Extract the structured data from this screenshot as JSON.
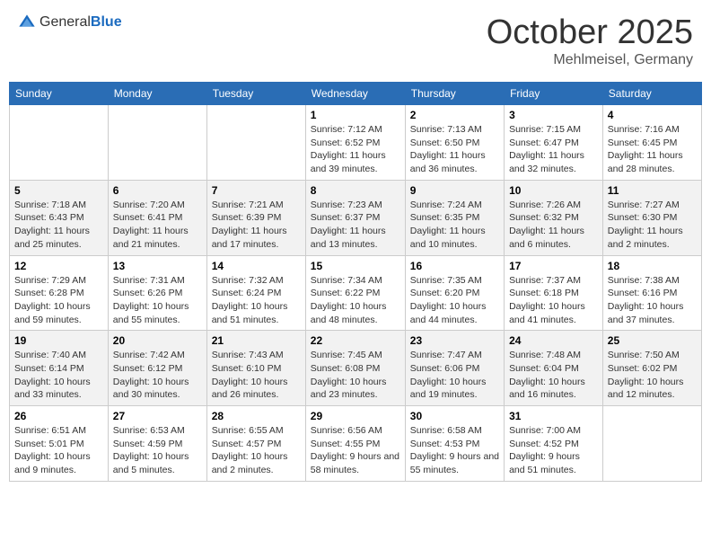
{
  "header": {
    "logo_general": "General",
    "logo_blue": "Blue",
    "title": "October 2025",
    "subtitle": "Mehlmeisel, Germany"
  },
  "days_of_week": [
    "Sunday",
    "Monday",
    "Tuesday",
    "Wednesday",
    "Thursday",
    "Friday",
    "Saturday"
  ],
  "weeks": [
    {
      "days": [
        {
          "num": "",
          "info": ""
        },
        {
          "num": "",
          "info": ""
        },
        {
          "num": "",
          "info": ""
        },
        {
          "num": "1",
          "info": "Sunrise: 7:12 AM\nSunset: 6:52 PM\nDaylight: 11 hours and 39 minutes."
        },
        {
          "num": "2",
          "info": "Sunrise: 7:13 AM\nSunset: 6:50 PM\nDaylight: 11 hours and 36 minutes."
        },
        {
          "num": "3",
          "info": "Sunrise: 7:15 AM\nSunset: 6:47 PM\nDaylight: 11 hours and 32 minutes."
        },
        {
          "num": "4",
          "info": "Sunrise: 7:16 AM\nSunset: 6:45 PM\nDaylight: 11 hours and 28 minutes."
        }
      ]
    },
    {
      "days": [
        {
          "num": "5",
          "info": "Sunrise: 7:18 AM\nSunset: 6:43 PM\nDaylight: 11 hours and 25 minutes."
        },
        {
          "num": "6",
          "info": "Sunrise: 7:20 AM\nSunset: 6:41 PM\nDaylight: 11 hours and 21 minutes."
        },
        {
          "num": "7",
          "info": "Sunrise: 7:21 AM\nSunset: 6:39 PM\nDaylight: 11 hours and 17 minutes."
        },
        {
          "num": "8",
          "info": "Sunrise: 7:23 AM\nSunset: 6:37 PM\nDaylight: 11 hours and 13 minutes."
        },
        {
          "num": "9",
          "info": "Sunrise: 7:24 AM\nSunset: 6:35 PM\nDaylight: 11 hours and 10 minutes."
        },
        {
          "num": "10",
          "info": "Sunrise: 7:26 AM\nSunset: 6:32 PM\nDaylight: 11 hours and 6 minutes."
        },
        {
          "num": "11",
          "info": "Sunrise: 7:27 AM\nSunset: 6:30 PM\nDaylight: 11 hours and 2 minutes."
        }
      ]
    },
    {
      "days": [
        {
          "num": "12",
          "info": "Sunrise: 7:29 AM\nSunset: 6:28 PM\nDaylight: 10 hours and 59 minutes."
        },
        {
          "num": "13",
          "info": "Sunrise: 7:31 AM\nSunset: 6:26 PM\nDaylight: 10 hours and 55 minutes."
        },
        {
          "num": "14",
          "info": "Sunrise: 7:32 AM\nSunset: 6:24 PM\nDaylight: 10 hours and 51 minutes."
        },
        {
          "num": "15",
          "info": "Sunrise: 7:34 AM\nSunset: 6:22 PM\nDaylight: 10 hours and 48 minutes."
        },
        {
          "num": "16",
          "info": "Sunrise: 7:35 AM\nSunset: 6:20 PM\nDaylight: 10 hours and 44 minutes."
        },
        {
          "num": "17",
          "info": "Sunrise: 7:37 AM\nSunset: 6:18 PM\nDaylight: 10 hours and 41 minutes."
        },
        {
          "num": "18",
          "info": "Sunrise: 7:38 AM\nSunset: 6:16 PM\nDaylight: 10 hours and 37 minutes."
        }
      ]
    },
    {
      "days": [
        {
          "num": "19",
          "info": "Sunrise: 7:40 AM\nSunset: 6:14 PM\nDaylight: 10 hours and 33 minutes."
        },
        {
          "num": "20",
          "info": "Sunrise: 7:42 AM\nSunset: 6:12 PM\nDaylight: 10 hours and 30 minutes."
        },
        {
          "num": "21",
          "info": "Sunrise: 7:43 AM\nSunset: 6:10 PM\nDaylight: 10 hours and 26 minutes."
        },
        {
          "num": "22",
          "info": "Sunrise: 7:45 AM\nSunset: 6:08 PM\nDaylight: 10 hours and 23 minutes."
        },
        {
          "num": "23",
          "info": "Sunrise: 7:47 AM\nSunset: 6:06 PM\nDaylight: 10 hours and 19 minutes."
        },
        {
          "num": "24",
          "info": "Sunrise: 7:48 AM\nSunset: 6:04 PM\nDaylight: 10 hours and 16 minutes."
        },
        {
          "num": "25",
          "info": "Sunrise: 7:50 AM\nSunset: 6:02 PM\nDaylight: 10 hours and 12 minutes."
        }
      ]
    },
    {
      "days": [
        {
          "num": "26",
          "info": "Sunrise: 6:51 AM\nSunset: 5:01 PM\nDaylight: 10 hours and 9 minutes."
        },
        {
          "num": "27",
          "info": "Sunrise: 6:53 AM\nSunset: 4:59 PM\nDaylight: 10 hours and 5 minutes."
        },
        {
          "num": "28",
          "info": "Sunrise: 6:55 AM\nSunset: 4:57 PM\nDaylight: 10 hours and 2 minutes."
        },
        {
          "num": "29",
          "info": "Sunrise: 6:56 AM\nSunset: 4:55 PM\nDaylight: 9 hours and 58 minutes."
        },
        {
          "num": "30",
          "info": "Sunrise: 6:58 AM\nSunset: 4:53 PM\nDaylight: 9 hours and 55 minutes."
        },
        {
          "num": "31",
          "info": "Sunrise: 7:00 AM\nSunset: 4:52 PM\nDaylight: 9 hours and 51 minutes."
        },
        {
          "num": "",
          "info": ""
        }
      ]
    }
  ]
}
